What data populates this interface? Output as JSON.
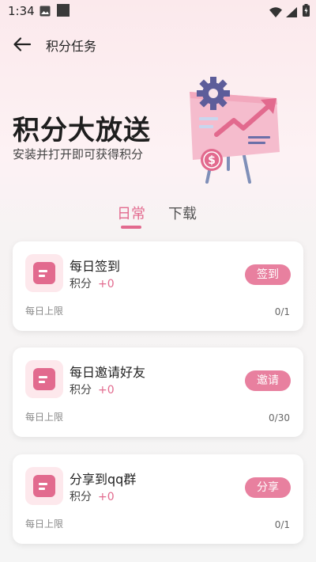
{
  "status_bar": {
    "time": "1:34"
  },
  "header": {
    "title": "积分任务"
  },
  "hero": {
    "title": "积分大放送",
    "subtitle": "安装并打开即可获得积分"
  },
  "tabs": [
    {
      "label": "日常",
      "active": true
    },
    {
      "label": "下载",
      "active": false
    }
  ],
  "tasks": [
    {
      "name": "每日签到",
      "points_label": "积分",
      "points_value": "+0",
      "action": "签到",
      "limit_label": "每日上限",
      "limit_value": "0/1"
    },
    {
      "name": "每日邀请好友",
      "points_label": "积分",
      "points_value": "+0",
      "action": "邀请",
      "limit_label": "每日上限",
      "limit_value": "0/30"
    },
    {
      "name": "分享到qq群",
      "points_label": "积分",
      "points_value": "+0",
      "action": "分享",
      "limit_label": "每日上限",
      "limit_value": "0/1"
    }
  ],
  "colors": {
    "accent": "#e26a8e",
    "button": "#e8809f",
    "icon_bg": "#fde8ec"
  }
}
